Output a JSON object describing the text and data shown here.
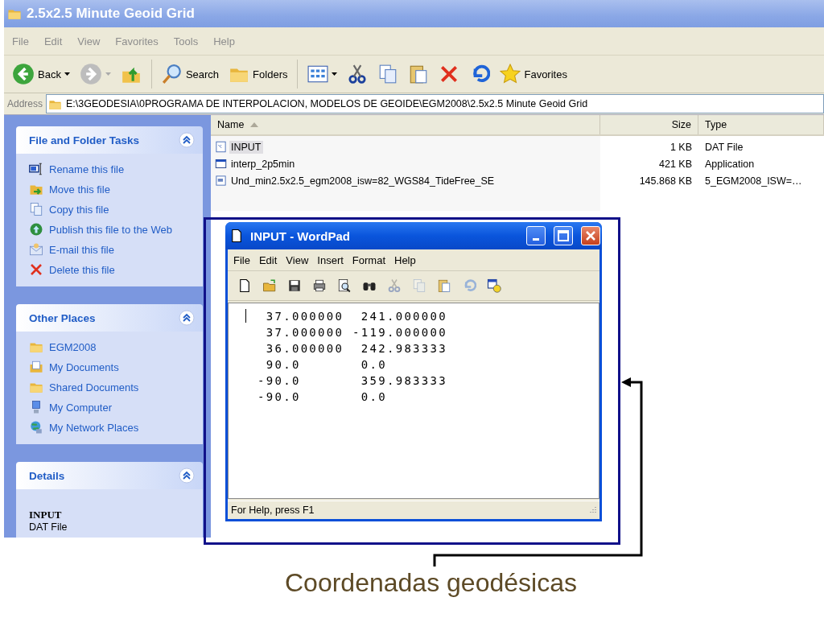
{
  "window": {
    "title": "2.5x2.5 Minute Geoid Grid"
  },
  "menu": [
    "File",
    "Edit",
    "View",
    "Favorites",
    "Tools",
    "Help"
  ],
  "toolbar": [
    {
      "kind": "back",
      "label": "Back"
    },
    {
      "kind": "forward"
    },
    {
      "kind": "up"
    },
    {
      "kind": "search",
      "label": "Search"
    },
    {
      "kind": "folders",
      "label": "Folders"
    },
    {
      "kind": "views"
    },
    {
      "kind": "cut"
    },
    {
      "kind": "copy"
    },
    {
      "kind": "paste"
    },
    {
      "kind": "delete"
    },
    {
      "kind": "undo"
    },
    {
      "kind": "favorites",
      "label": "Favorites"
    }
  ],
  "address": {
    "label": "Address",
    "value": "E:\\3GEODESIA\\0PROGRAMA DE INTERPOLACION, MODELOS DE GEOIDE\\EGM2008\\2.5x2.5 Minute Geoid Grid"
  },
  "sidebar": {
    "panels": [
      {
        "title": "File and Folder Tasks",
        "items": [
          {
            "kind": "rename",
            "label": "Rename this file"
          },
          {
            "kind": "move",
            "label": "Move this file"
          },
          {
            "kind": "copy",
            "label": "Copy this file"
          },
          {
            "kind": "web",
            "label": "Publish this file to the Web"
          },
          {
            "kind": "email",
            "label": "E-mail this file"
          },
          {
            "kind": "delete",
            "label": "Delete this file"
          }
        ]
      },
      {
        "title": "Other Places",
        "items": [
          {
            "kind": "folder",
            "label": "EGM2008"
          },
          {
            "kind": "documents",
            "label": "My Documents"
          },
          {
            "kind": "folder",
            "label": "Shared Documents"
          },
          {
            "kind": "computer",
            "label": "My Computer"
          },
          {
            "kind": "network",
            "label": "My Network Places"
          }
        ]
      },
      {
        "title": "Details",
        "details": {
          "name": "INPUT",
          "type": "DAT File"
        }
      }
    ]
  },
  "table": {
    "columns": [
      {
        "label": "Name",
        "sorted": true
      },
      {
        "label": "Size"
      },
      {
        "label": "Type"
      }
    ],
    "rows": [
      {
        "kind": "document",
        "name": "INPUT",
        "size": "1 KB",
        "type": "DAT File",
        "selected": true
      },
      {
        "kind": "application",
        "name": "interp_2p5min",
        "size": "421 KB",
        "type": "Application",
        "selected": false
      },
      {
        "kind": "data",
        "name": "Und_min2.5x2.5_egm2008_isw=82_WGS84_TideFree_SE",
        "size": "145.868 KB",
        "type": "5_EGM2008_ISW=…",
        "selected": false
      }
    ]
  },
  "wordpad": {
    "title": "INPUT - WordPad",
    "menu": [
      "File",
      "Edit",
      "View",
      "Insert",
      "Format",
      "Help"
    ],
    "tools": [
      {
        "kind": "new",
        "enabled": true
      },
      {
        "kind": "open",
        "enabled": true
      },
      {
        "kind": "save",
        "enabled": true
      },
      {
        "kind": "print",
        "enabled": true
      },
      {
        "kind": "preview",
        "enabled": true
      },
      {
        "kind": "find",
        "enabled": true
      },
      {
        "kind": "cut",
        "enabled": false
      },
      {
        "kind": "copy",
        "enabled": false
      },
      {
        "kind": "paste",
        "enabled": true
      },
      {
        "kind": "undo",
        "enabled": false
      },
      {
        "kind": "datetime",
        "enabled": true
      }
    ],
    "lines": [
      " 37.000000  241.000000",
      " 37.000000 -119.000000",
      " 36.000000  242.983333",
      " 90.0       0.0",
      "-90.0       359.983333",
      "-90.0       0.0"
    ],
    "status": "For Help, press F1"
  },
  "caption": "Coordenadas geodésicas"
}
